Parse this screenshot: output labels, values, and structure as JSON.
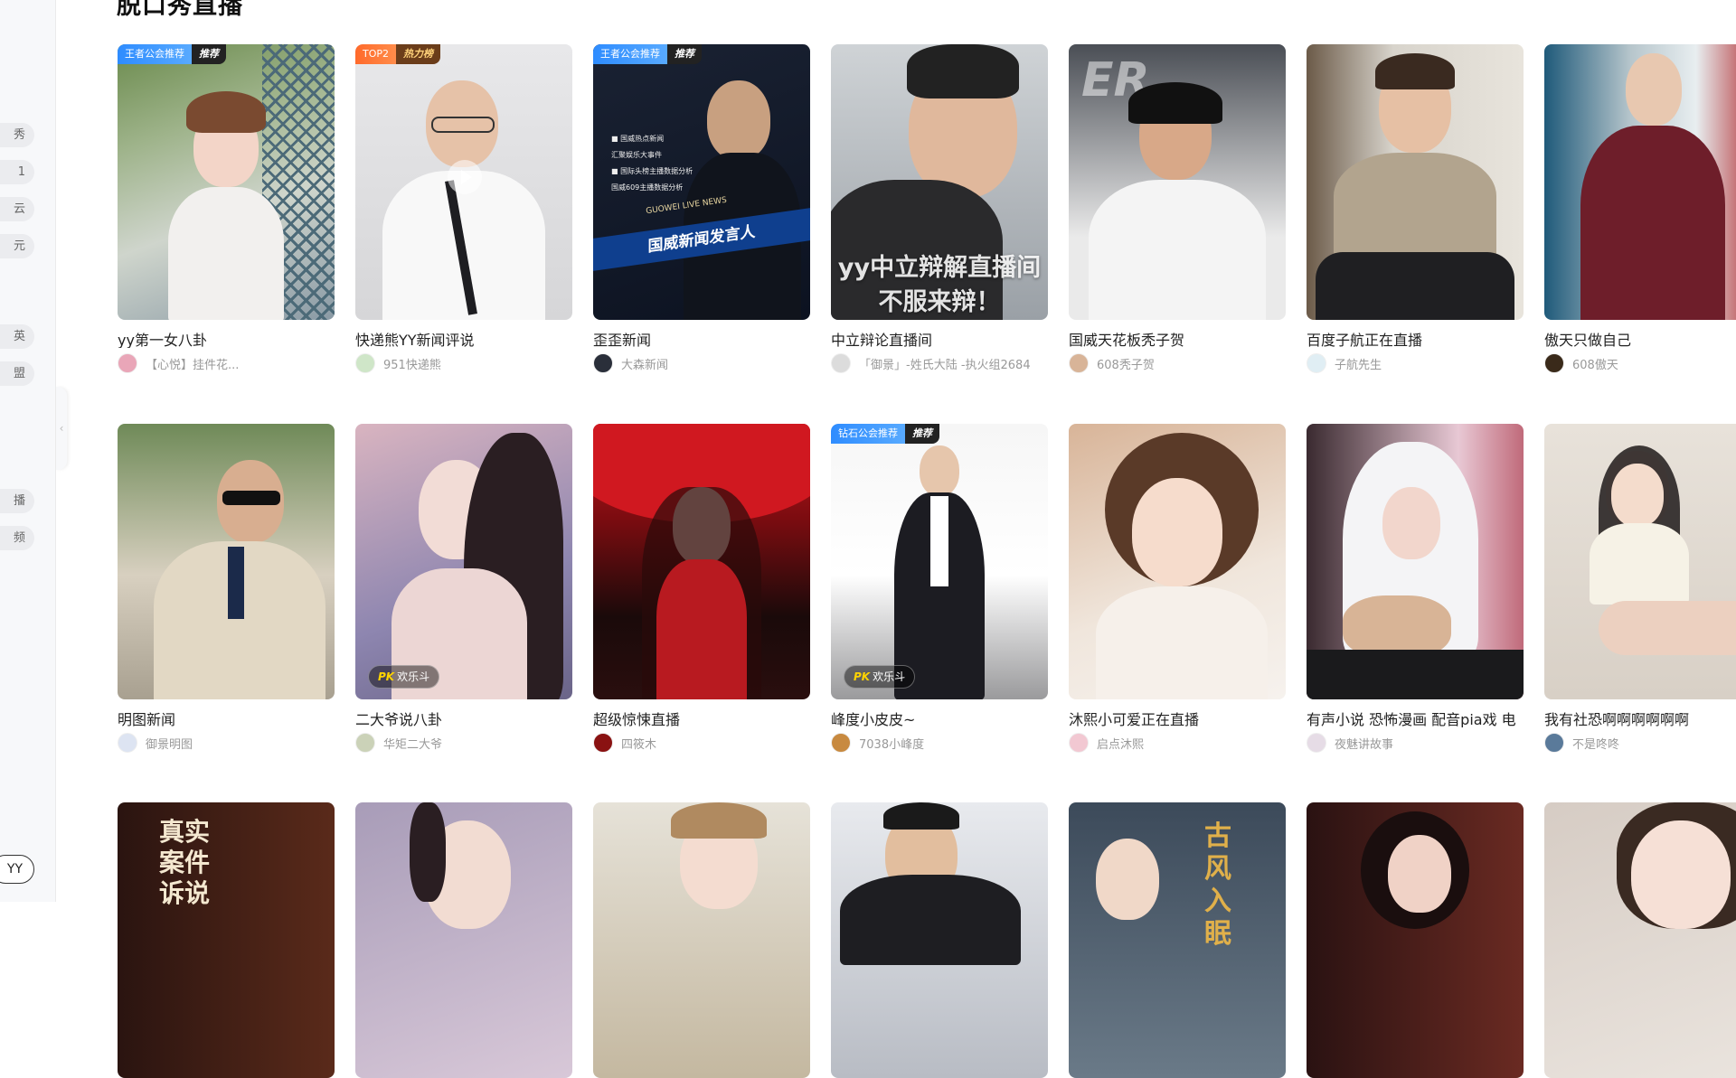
{
  "section": {
    "title": "脱口秀直播"
  },
  "sidebar": {
    "items": [
      {
        "label": "秀"
      },
      {
        "label": "1"
      },
      {
        "label": "云"
      },
      {
        "label": "元"
      },
      {
        "label": "英"
      },
      {
        "label": "盟"
      },
      {
        "label": "播"
      },
      {
        "label": "频"
      }
    ],
    "bottom_button": "YY",
    "collapse_icon": "chevron-left-icon"
  },
  "rows": [
    [
      {
        "title": "yy第一女八卦",
        "user": "【心悦】挂件花...",
        "badge": "王者公会推荐",
        "tag": "推荐"
      },
      {
        "title": "快递熊YY新闻评说",
        "user": "951快递熊",
        "badge": "TOP2",
        "tag": "热力榜"
      },
      {
        "title": "歪歪新闻",
        "user": "大森新闻",
        "badge": "王者公会推荐",
        "tag": "推荐",
        "poster_line1": "■ 国威热点新闻",
        "poster_line2": "汇聚娱乐大事件",
        "poster_line3": "■ 国际头榜主播数据分析",
        "poster_line4": "国威609主播数据分析",
        "poster_small": "GUOWEI LIVE NEWS",
        "poster_banner": "国威新闻发言人"
      },
      {
        "title": "中立辩论直播间",
        "user": "「御景」-姓氏大陆 -执火组2684",
        "overlay1": "yy中立辩解直播间",
        "overlay2": "不服来辩！"
      },
      {
        "title": "国威天花板秃子贺",
        "user": "608秃子贺"
      },
      {
        "title": "百度子航正在直播",
        "user": "子航先生"
      },
      {
        "title": "傲天只做自己",
        "user": "608傲天"
      }
    ],
    [
      {
        "title": "明图新闻",
        "user": "御景明图"
      },
      {
        "title": "二大爷说八卦",
        "user": "华矩二大爷",
        "pk": "欢乐斗",
        "pk_mark": "PK"
      },
      {
        "title": "超级惊悚直播",
        "user": "四筱木"
      },
      {
        "title": "峰度小皮皮~",
        "user": "7038小峰度",
        "badge": "钻石公会推荐",
        "tag": "推荐",
        "pk": "欢乐斗",
        "pk_mark": "PK"
      },
      {
        "title": "沐熙小可爱正在直播",
        "user": "启点沐熙"
      },
      {
        "title": "有声小说 恐怖漫画 配音pia戏 电",
        "user": "夜魅讲故事"
      },
      {
        "title": "我有社恐啊啊啊啊啊啊",
        "user": "不是咚咚"
      }
    ],
    [
      {
        "overlay_v": "真实案件 诉说"
      },
      {},
      {},
      {},
      {
        "overlay_v": "古风 入眠"
      },
      {},
      {}
    ]
  ]
}
